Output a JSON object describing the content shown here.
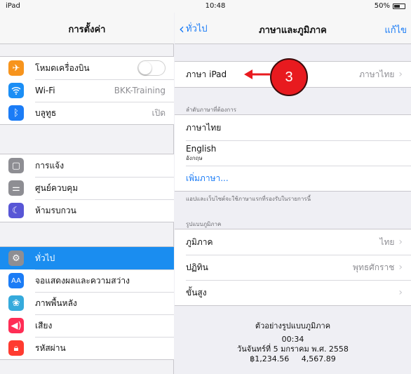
{
  "status": {
    "device": "iPad",
    "time": "10:48",
    "battery": "50%"
  },
  "sidebar": {
    "title": "การตั้งค่า",
    "group1": [
      {
        "label": "โหมดเครื่องบิน",
        "icon": "airplane-icon",
        "color": "#f7941d",
        "toggle": false
      },
      {
        "label": "Wi-Fi",
        "icon": "wifi-icon",
        "color": "#1b8ef5",
        "value": "BKK-Training"
      },
      {
        "label": "บลูทูธ",
        "icon": "bluetooth-icon",
        "color": "#1b7cf6",
        "value": "เปิด"
      }
    ],
    "group2": [
      {
        "label": "การแจ้ง",
        "icon": "notification-icon",
        "color": "#8e8e93"
      },
      {
        "label": "ศูนย์ควบคุม",
        "icon": "control-center-icon",
        "color": "#8e8e93"
      },
      {
        "label": "ห้ามรบกวน",
        "icon": "moon-icon",
        "color": "#5856d6"
      }
    ],
    "group3": [
      {
        "label": "ทั่วไป",
        "icon": "gear-icon",
        "color": "#8e8e93",
        "selected": true
      },
      {
        "label": "จอแสดงผลและความสว่าง",
        "icon": "display-icon",
        "color": "#1b7cf6"
      },
      {
        "label": "ภาพพื้นหลัง",
        "icon": "wallpaper-icon",
        "color": "#35aadc"
      },
      {
        "label": "เสียง",
        "icon": "sound-icon",
        "color": "#ff2d55"
      },
      {
        "label": "รหัสผ่าน",
        "icon": "lock-icon",
        "color": "#ff3b30"
      }
    ]
  },
  "detail": {
    "back_label": "ทั่วไป",
    "title": "ภาษาและภูมิภาค",
    "edit_label": "แก้ไข",
    "ipad_language": {
      "label": "ภาษา iPad",
      "value": "ภาษาไทย"
    },
    "preferred_header": "ลำดับภาษาที่ต้องการ",
    "preferred": [
      {
        "label": "ภาษาไทย"
      },
      {
        "label": "English",
        "sub": "อังกฤษ"
      }
    ],
    "add_language": "เพิ่มภาษา...",
    "preferred_footer": "แอปและเว็บไซต์จะใช้ภาษาแรกที่รองรับในรายการนี้",
    "region_header": "รูปแบบภูมิภาค",
    "region": [
      {
        "label": "ภูมิภาค",
        "value": "ไทย"
      },
      {
        "label": "ปฏิทิน",
        "value": "พุทธศักราช"
      },
      {
        "label": "ขั้นสูง",
        "value": ""
      }
    ],
    "sample": {
      "title": "ตัวอย่างรูปแบบภูมิภาค",
      "time": "00:34",
      "date": "วันจันทร์ที่ 5 มกราคม พ.ศ. 2558",
      "numbers": "฿1,234.56     4,567.89"
    }
  },
  "annotation": {
    "badge": "3",
    "color": "#e81a1f"
  }
}
